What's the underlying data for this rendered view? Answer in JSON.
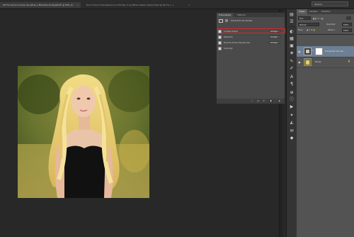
{
  "tabs": [
    {
      "label": "Pxl Fix Lecons Cursos de Letras y Mientras de España® @ 50% (Y...",
      "active": true
    },
    {
      "label": "Doom Punch transparence en PS Pay 3.14_Mfrenchasee Clamp Enb4 @ 66.7% (...)",
      "active": false
    }
  ],
  "search": {
    "value": "Textura"
  },
  "properties": {
    "tabs": [
      "Propiedades",
      "Historial"
    ],
    "header_title": "Corrección de colores",
    "rows": [
      {
        "label": "Ya Rote Deboll",
        "mode": "Corregir",
        "checked": true,
        "highlighted": true
      },
      {
        "label": "Restraint",
        "mode": "Corregir",
        "checked": true,
        "highlighted": false
      },
      {
        "label": "Decode Ambe Haveshurse",
        "mode": "Corregir",
        "checked": true,
        "highlighted": false
      },
      {
        "label": "Sumergir",
        "mode": "",
        "checked": true,
        "highlighted": false
      }
    ]
  },
  "layers_panel": {
    "tabs": [
      "Capas",
      "Canales",
      "Trazados"
    ],
    "kind_label": "Tipo",
    "blend_mode": "Normal",
    "opacity_label": "Opacidad:",
    "opacity_value": "100%",
    "lock_label": "Bloq.:",
    "fill_label": "Relleno:",
    "fill_value": "100%",
    "layers": [
      {
        "name": "Corrección de colo...",
        "selected": true
      },
      {
        "name": "Fondo",
        "selected": false
      }
    ]
  },
  "icons": {
    "close": "close-icon",
    "eye": "eye-icon",
    "chevron": "chevron-down-icon"
  },
  "colors": {
    "highlight": "#d9252a",
    "selection": "#6d7f92"
  }
}
